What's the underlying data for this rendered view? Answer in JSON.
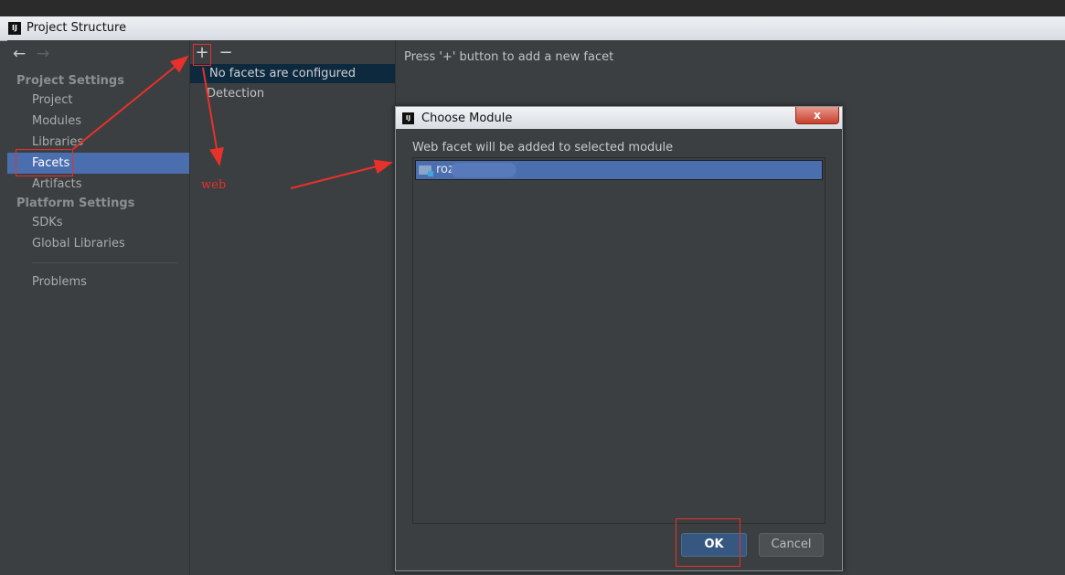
{
  "window": {
    "title": "Project Structure",
    "logo": "IJ"
  },
  "nav": {
    "back_icon": "←",
    "forward_icon": "→"
  },
  "sidebar": {
    "project_settings": "Project Settings",
    "items_project": [
      "Project",
      "Modules",
      "Libraries",
      "Facets",
      "Artifacts"
    ],
    "platform_settings": "Platform Settings",
    "items_platform": [
      "SDKs",
      "Global Libraries"
    ],
    "problems": "Problems",
    "selected": "Facets"
  },
  "toolbar": {
    "add": "+",
    "remove": "−"
  },
  "facets": {
    "empty": "No facets are configured",
    "detection": "Detection"
  },
  "hint": "Press '+' button to add a new facet",
  "dialog": {
    "title": "Choose Module",
    "logo": "IJ",
    "close": "x",
    "label": "Web facet will be added to selected module",
    "module": "roz",
    "ok": "OK",
    "cancel": "Cancel"
  },
  "annotation": {
    "text": "web",
    "color": "#e8312a"
  }
}
